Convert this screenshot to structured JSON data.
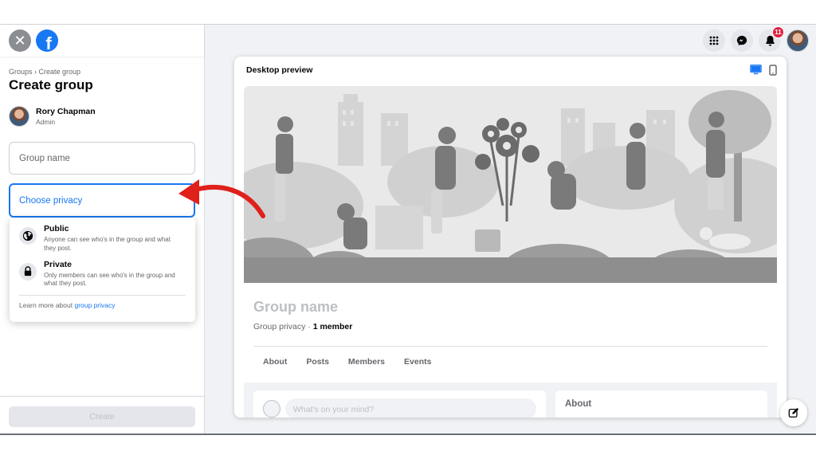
{
  "left_panel": {
    "breadcrumb": "Groups › Create group",
    "title": "Create group",
    "user": {
      "name": "Rory Chapman",
      "role": "Admin"
    },
    "group_name_placeholder": "Group name",
    "privacy_select_label": "Choose privacy",
    "privacy_options": [
      {
        "title": "Public",
        "description": "Anyone can see who's in the group and what they post.",
        "icon": "globe-icon"
      },
      {
        "title": "Private",
        "description": "Only members can see who's in the group and what they post.",
        "icon": "lock-icon"
      }
    ],
    "learn_more_prefix": "Learn more about ",
    "learn_more_link": "group privacy",
    "create_label": "Create"
  },
  "top_nav": {
    "notification_count": "11",
    "icons": [
      "grid-menu-icon",
      "messenger-icon",
      "bell-icon",
      "avatar"
    ]
  },
  "preview": {
    "label": "Desktop preview",
    "group_name": "Group name",
    "group_privacy": "Group privacy",
    "separator": " · ",
    "member_count": "1 member",
    "tabs": [
      "About",
      "Posts",
      "Members",
      "Events"
    ],
    "composer_placeholder": "What's on your mind?",
    "about_title": "About"
  },
  "colors": {
    "brand": "#1877f2",
    "annotation_arrow": "#e0201b",
    "badge": "#e41e3f"
  }
}
